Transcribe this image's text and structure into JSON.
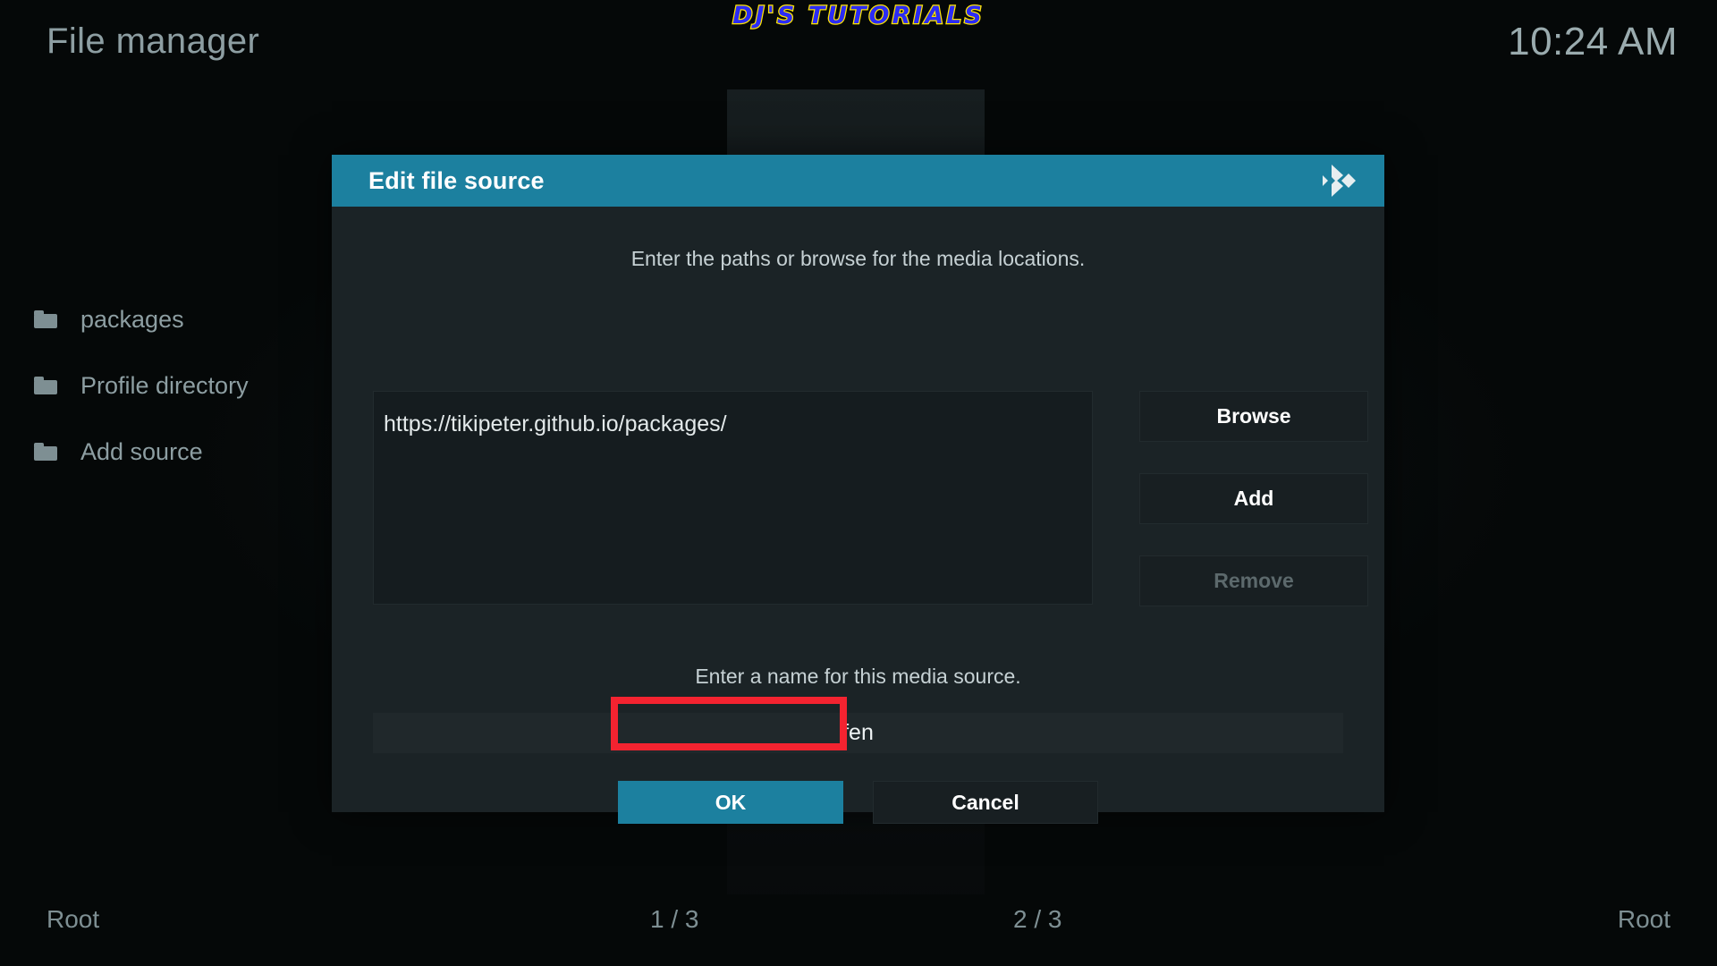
{
  "app": {
    "page_title": "File manager",
    "clock": "10:24 AM",
    "watermark": "DJ'S TUTORIALS"
  },
  "sidebar": {
    "items": [
      {
        "label": "packages",
        "icon": "folder-icon"
      },
      {
        "label": "Profile directory",
        "icon": "folder-icon"
      },
      {
        "label": "Add source",
        "icon": "folder-icon"
      }
    ]
  },
  "dialog": {
    "title": "Edit file source",
    "logo_icon": "kodi-logo-icon",
    "hint": "Enter the paths or browse for the media locations.",
    "path_value": "https://tikipeter.github.io/packages/",
    "buttons": {
      "browse": "Browse",
      "add": "Add",
      "remove": "Remove",
      "remove_disabled": true
    },
    "name_hint": "Enter a name for this media source.",
    "name_value": "fen",
    "ok": "OK",
    "cancel": "Cancel",
    "focused_button": "OK"
  },
  "bottom_bar": {
    "left": "Root",
    "page_left": "1 / 3",
    "page_right": "2 / 3",
    "right": "Root"
  },
  "colors": {
    "accent": "#1c809f",
    "highlight": "#f42330",
    "logo_fill": "#2b2bf5",
    "logo_stroke": "#ffe500",
    "text_muted": "#8d9ea2",
    "dialog_bg": "#1b2326"
  }
}
